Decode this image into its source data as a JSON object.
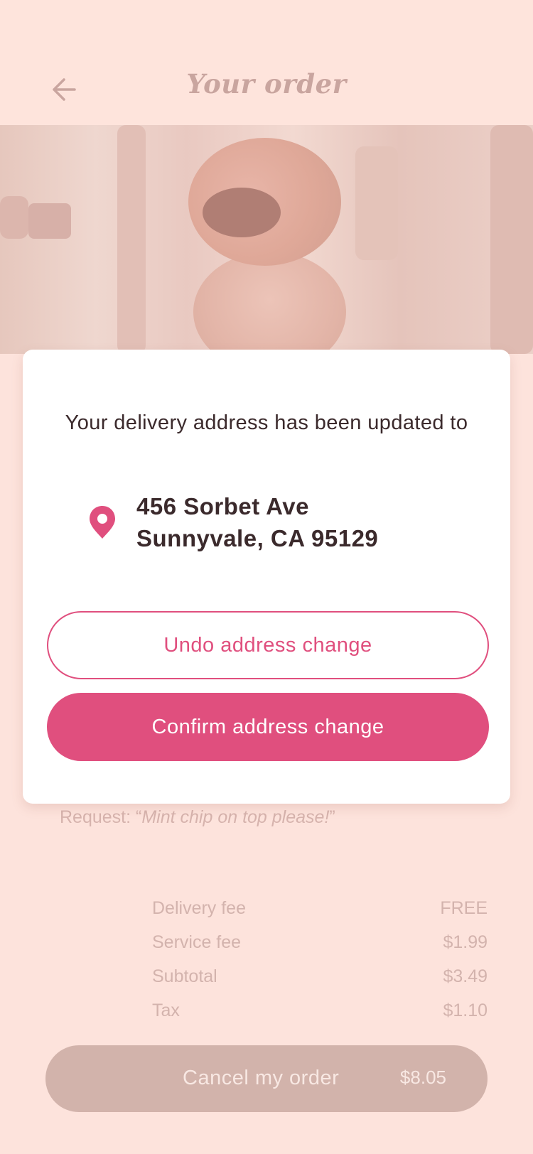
{
  "header": {
    "title": "Your order",
    "back_icon": "arrow-left-icon"
  },
  "order": {
    "request_label": "Request: “",
    "request_text": "Mint chip on top please!",
    "request_close": "”",
    "fees": [
      {
        "label": "Delivery fee",
        "value": "FREE"
      },
      {
        "label": "Service fee",
        "value": "$1.99"
      },
      {
        "label": "Subtotal",
        "value": "$3.49"
      },
      {
        "label": "Tax",
        "value": "$1.10"
      }
    ],
    "cancel_label": "Cancel my order",
    "total": "$8.05"
  },
  "modal": {
    "message": "Your delivery address has been updated to",
    "address_line1": "456 Sorbet Ave",
    "address_line2": "Sunnyvale, CA 95129",
    "pin_icon": "location-pin-icon",
    "undo_label": "Undo address change",
    "confirm_label": "Confirm address change"
  },
  "colors": {
    "accent": "#e04f7e",
    "background": "#fde3dc",
    "text_dark": "#3b2a2c"
  }
}
